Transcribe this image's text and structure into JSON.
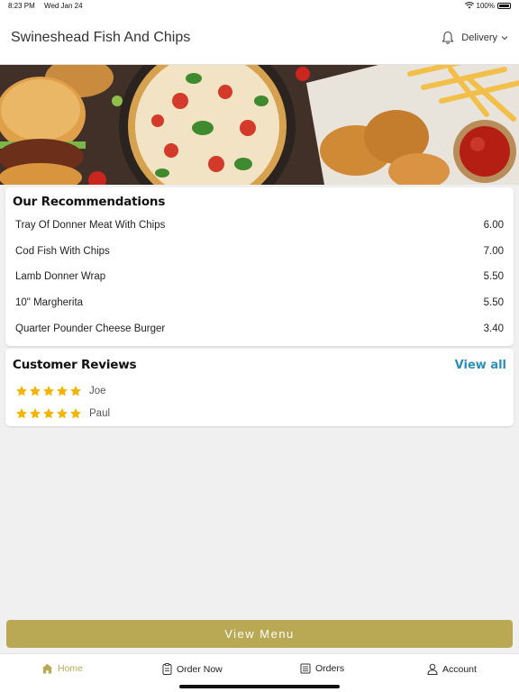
{
  "status_bar": {
    "time": "8:23 PM",
    "date": "Wed Jan 24",
    "battery": "100%"
  },
  "header": {
    "title": "Swineshead Fish And Chips",
    "delivery_label": "Delivery"
  },
  "recommendations": {
    "title": "Our Recommendations",
    "items": [
      {
        "name": "Tray Of Donner Meat With Chips",
        "price": "6.00"
      },
      {
        "name": "Cod Fish With Chips",
        "price": "7.00"
      },
      {
        "name": "Lamb Donner Wrap",
        "price": "5.50"
      },
      {
        "name": "10\" Margherita",
        "price": "5.50"
      },
      {
        "name": "Quarter Pounder Cheese Burger",
        "price": "3.40"
      }
    ]
  },
  "reviews": {
    "title": "Customer Reviews",
    "view_all_label": "View all",
    "items": [
      {
        "name": "Joe",
        "rating": 5
      },
      {
        "name": "Paul",
        "rating": 5
      }
    ]
  },
  "view_menu_label": "View Menu",
  "tabs": [
    {
      "label": "Home",
      "icon": "home-icon",
      "active": true
    },
    {
      "label": "Order Now",
      "icon": "order-icon",
      "active": false
    },
    {
      "label": "Orders",
      "icon": "orders-list-icon",
      "active": false
    },
    {
      "label": "Account",
      "icon": "account-icon",
      "active": false
    }
  ],
  "colors": {
    "accent": "#b9a854",
    "link": "#2a8fb8",
    "star": "#f5b400"
  }
}
